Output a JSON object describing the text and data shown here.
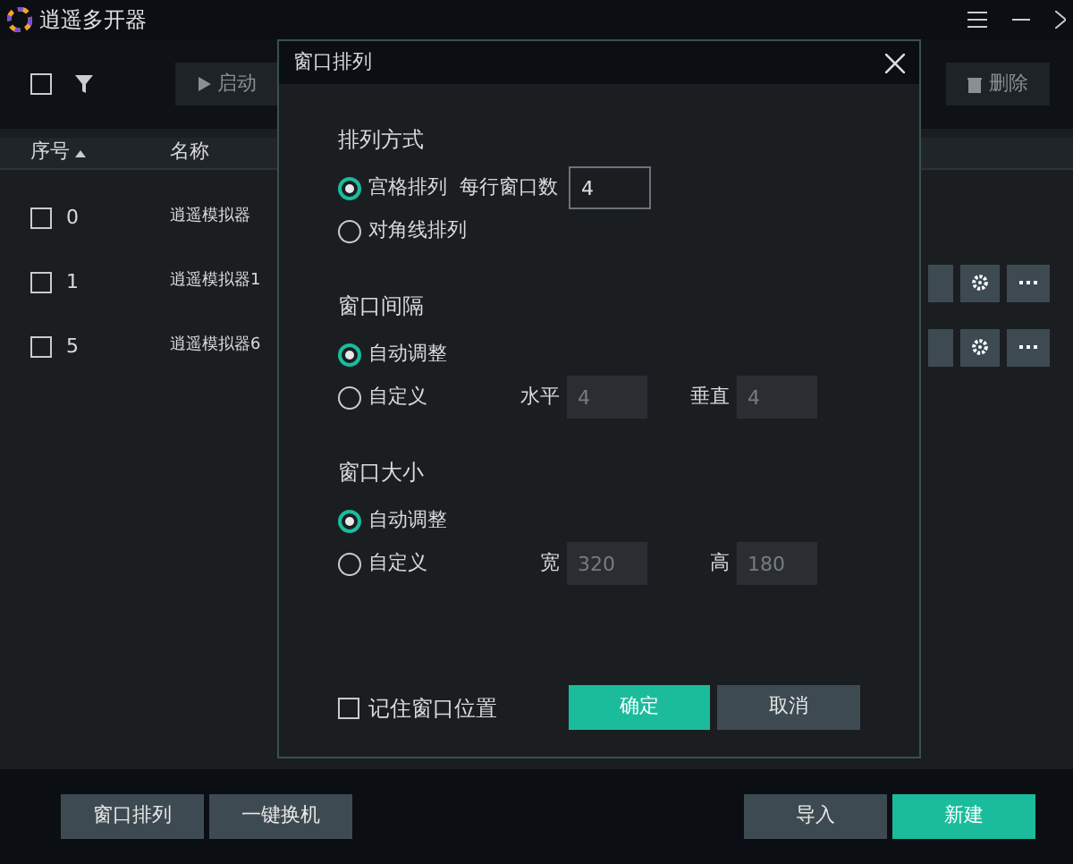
{
  "app": {
    "title": "逍遥多开器"
  },
  "toolbar": {
    "select_all_checked": false,
    "start_button": "启动",
    "delete_button": "删除"
  },
  "table": {
    "columns": [
      {
        "label": "序号",
        "sorted_ascending": true
      },
      {
        "label": "名称"
      }
    ],
    "rows": [
      {
        "index": "0",
        "name": "逍遥模拟器",
        "checked": false,
        "show_actions": false
      },
      {
        "index": "1",
        "name": "逍遥模拟器1",
        "checked": false,
        "show_actions": true
      },
      {
        "index": "5",
        "name": "逍遥模拟器6",
        "checked": false,
        "show_actions": true
      }
    ]
  },
  "dialog": {
    "title": "窗口排列",
    "sections": [
      {
        "title": "排列方式",
        "options": [
          {
            "label": "宫格排列",
            "selected": true,
            "kind": "per_row",
            "field_label": "每行窗口数",
            "value": "4"
          },
          {
            "label": "对角线排列",
            "selected": false,
            "kind": "plain"
          }
        ]
      },
      {
        "title": "窗口间隔",
        "options": [
          {
            "label": "自动调整",
            "selected": true,
            "kind": "plain"
          },
          {
            "label": "自定义",
            "selected": false,
            "kind": "pair",
            "fields": [
              {
                "label": "水平",
                "value": "4"
              },
              {
                "label": "垂直",
                "value": "4"
              }
            ]
          }
        ]
      },
      {
        "title": "窗口大小",
        "options": [
          {
            "label": "自动调整",
            "selected": true,
            "kind": "plain"
          },
          {
            "label": "自定义",
            "selected": false,
            "kind": "pair",
            "fields": [
              {
                "label": "宽",
                "value": "320"
              },
              {
                "label": "高",
                "value": "180"
              }
            ]
          }
        ]
      }
    ],
    "remember": {
      "label": "记住窗口位置",
      "checked": false
    },
    "ok_button": "确定",
    "cancel_button": "取消"
  },
  "bottom_bar": {
    "left_buttons": [
      "窗口排列",
      "一键换机"
    ],
    "import_button": "导入",
    "new_button": "新建"
  }
}
